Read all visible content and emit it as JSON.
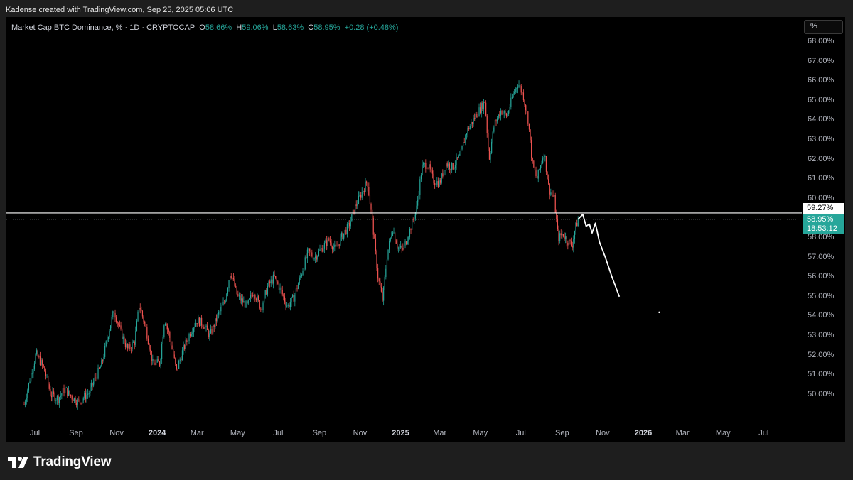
{
  "credit": "Kadense created with TradingView.com, Sep 25, 2025 05:06 UTC",
  "brand": "TradingView",
  "unit_button": "%",
  "legend": {
    "symbol": "Market Cap BTC Dominance, % · 1D · CRYPTOCAP",
    "o_label": "O",
    "o": "58.66%",
    "h_label": "H",
    "h": "59.06%",
    "l_label": "L",
    "l": "58.63%",
    "c_label": "C",
    "c": "58.95%",
    "change": "+0.28 (+0.48%)"
  },
  "level_label": "59.27%",
  "current_label": {
    "price": "58.95%",
    "countdown": "18:53:12"
  },
  "colors": {
    "up": "#26a69a",
    "down": "#ef5350",
    "level": "#ffffff",
    "drawing": "#ffffff",
    "background": "#000000"
  },
  "chart_data": {
    "type": "line",
    "title": "Market Cap BTC Dominance, % · 1D · CRYPTOCAP",
    "ylabel": "%",
    "ylim": [
      49.5,
      68.7
    ],
    "yticks": [
      "68.00%",
      "67.00%",
      "66.00%",
      "65.00%",
      "64.00%",
      "63.00%",
      "62.00%",
      "61.00%",
      "60.00%",
      "58.00%",
      "57.00%",
      "56.00%",
      "55.00%",
      "54.00%",
      "53.00%",
      "52.00%",
      "51.00%",
      "50.00%"
    ],
    "xticks": [
      {
        "label": "Jul",
        "date": "2023-07-01",
        "bold": false
      },
      {
        "label": "Sep",
        "date": "2023-09-01",
        "bold": false
      },
      {
        "label": "Nov",
        "date": "2023-11-01",
        "bold": false
      },
      {
        "label": "2024",
        "date": "2024-01-01",
        "bold": true
      },
      {
        "label": "Mar",
        "date": "2024-03-01",
        "bold": false
      },
      {
        "label": "May",
        "date": "2024-05-01",
        "bold": false
      },
      {
        "label": "Jul",
        "date": "2024-07-01",
        "bold": false
      },
      {
        "label": "Sep",
        "date": "2024-09-01",
        "bold": false
      },
      {
        "label": "Nov",
        "date": "2024-11-01",
        "bold": false
      },
      {
        "label": "2025",
        "date": "2025-01-01",
        "bold": true
      },
      {
        "label": "Mar",
        "date": "2025-03-01",
        "bold": false
      },
      {
        "label": "May",
        "date": "2025-05-01",
        "bold": false
      },
      {
        "label": "Jul",
        "date": "2025-07-01",
        "bold": false
      },
      {
        "label": "Sep",
        "date": "2025-09-01",
        "bold": false
      },
      {
        "label": "Nov",
        "date": "2025-11-01",
        "bold": false
      },
      {
        "label": "2026",
        "date": "2026-01-01",
        "bold": true
      },
      {
        "label": "Mar",
        "date": "2026-03-01",
        "bold": false
      },
      {
        "label": "May",
        "date": "2026-05-01",
        "bold": false
      },
      {
        "label": "Jul",
        "date": "2026-07-01",
        "bold": false
      }
    ],
    "series": [
      {
        "values_desc": "BTC dominance daily close (approximate)",
        "points": [
          [
            "2023-06-15",
            49.5
          ],
          [
            "2023-06-25",
            51.0
          ],
          [
            "2023-07-03",
            52.1
          ],
          [
            "2023-07-15",
            51.3
          ],
          [
            "2023-07-25",
            50.0
          ],
          [
            "2023-08-05",
            49.8
          ],
          [
            "2023-08-15",
            50.3
          ],
          [
            "2023-08-25",
            49.9
          ],
          [
            "2023-09-05",
            49.6
          ],
          [
            "2023-09-20",
            50.1
          ],
          [
            "2023-10-01",
            50.9
          ],
          [
            "2023-10-10",
            51.6
          ],
          [
            "2023-10-20",
            53.2
          ],
          [
            "2023-10-28",
            54.3
          ],
          [
            "2023-11-08",
            53.1
          ],
          [
            "2023-11-18",
            52.3
          ],
          [
            "2023-11-28",
            52.7
          ],
          [
            "2023-12-05",
            54.6
          ],
          [
            "2023-12-15",
            53.4
          ],
          [
            "2023-12-25",
            51.6
          ],
          [
            "2024-01-05",
            51.6
          ],
          [
            "2024-01-12",
            53.9
          ],
          [
            "2024-01-20",
            52.9
          ],
          [
            "2024-01-30",
            51.2
          ],
          [
            "2024-02-08",
            52.2
          ],
          [
            "2024-02-20",
            53.2
          ],
          [
            "2024-03-01",
            53.8
          ],
          [
            "2024-03-10",
            53.6
          ],
          [
            "2024-03-20",
            53.0
          ],
          [
            "2024-04-01",
            54.0
          ],
          [
            "2024-04-12",
            54.8
          ],
          [
            "2024-04-20",
            56.3
          ],
          [
            "2024-05-01",
            55.0
          ],
          [
            "2024-05-15",
            54.5
          ],
          [
            "2024-05-25",
            55.3
          ],
          [
            "2024-06-05",
            54.4
          ],
          [
            "2024-06-15",
            55.5
          ],
          [
            "2024-06-25",
            56.0
          ],
          [
            "2024-07-05",
            55.3
          ],
          [
            "2024-07-15",
            54.5
          ],
          [
            "2024-07-25",
            55.0
          ],
          [
            "2024-08-05",
            56.2
          ],
          [
            "2024-08-15",
            57.3
          ],
          [
            "2024-08-25",
            57.0
          ],
          [
            "2024-09-05",
            57.5
          ],
          [
            "2024-09-15",
            57.9
          ],
          [
            "2024-09-25",
            57.4
          ],
          [
            "2024-10-05",
            58.1
          ],
          [
            "2024-10-15",
            58.6
          ],
          [
            "2024-10-25",
            59.6
          ],
          [
            "2024-11-05",
            60.4
          ],
          [
            "2024-11-12",
            60.9
          ],
          [
            "2024-11-20",
            58.7
          ],
          [
            "2024-11-28",
            56.0
          ],
          [
            "2024-12-05",
            54.8
          ],
          [
            "2024-12-12",
            57.2
          ],
          [
            "2024-12-20",
            58.5
          ],
          [
            "2024-12-28",
            57.5
          ],
          [
            "2025-01-05",
            57.4
          ],
          [
            "2025-01-15",
            58.4
          ],
          [
            "2025-01-25",
            59.5
          ],
          [
            "2025-02-02",
            61.6
          ],
          [
            "2025-02-10",
            61.8
          ],
          [
            "2025-02-20",
            60.9
          ],
          [
            "2025-03-01",
            60.8
          ],
          [
            "2025-03-10",
            61.8
          ],
          [
            "2025-03-20",
            61.6
          ],
          [
            "2025-04-01",
            62.2
          ],
          [
            "2025-04-10",
            63.4
          ],
          [
            "2025-04-20",
            64.0
          ],
          [
            "2025-05-01",
            64.6
          ],
          [
            "2025-05-08",
            65.0
          ],
          [
            "2025-05-14",
            62.0
          ],
          [
            "2025-05-22",
            63.8
          ],
          [
            "2025-06-01",
            64.5
          ],
          [
            "2025-06-10",
            64.2
          ],
          [
            "2025-06-20",
            65.4
          ],
          [
            "2025-06-27",
            65.9
          ],
          [
            "2025-07-05",
            65.2
          ],
          [
            "2025-07-12",
            64.0
          ],
          [
            "2025-07-18",
            61.8
          ],
          [
            "2025-07-25",
            61.0
          ],
          [
            "2025-08-05",
            62.4
          ],
          [
            "2025-08-12",
            60.5
          ],
          [
            "2025-08-20",
            60.0
          ],
          [
            "2025-08-26",
            58.0
          ],
          [
            "2025-09-02",
            58.2
          ],
          [
            "2025-09-10",
            57.8
          ],
          [
            "2025-09-16",
            57.6
          ],
          [
            "2025-09-20",
            58.4
          ],
          [
            "2025-09-25",
            58.95
          ]
        ]
      }
    ],
    "horizontal_level": 59.27,
    "current_price": 58.95,
    "projection": [
      [
        "2025-09-25",
        58.95
      ],
      [
        "2025-10-02",
        59.2
      ],
      [
        "2025-10-07",
        58.6
      ],
      [
        "2025-10-12",
        58.7
      ],
      [
        "2025-10-16",
        58.25
      ],
      [
        "2025-10-21",
        58.75
      ],
      [
        "2025-10-27",
        57.8
      ],
      [
        "2025-11-05",
        57.0
      ],
      [
        "2025-11-15",
        56.0
      ],
      [
        "2025-11-26",
        55.0
      ]
    ],
    "marker": [
      "2026-01-25",
      54.2
    ],
    "grid": false
  }
}
